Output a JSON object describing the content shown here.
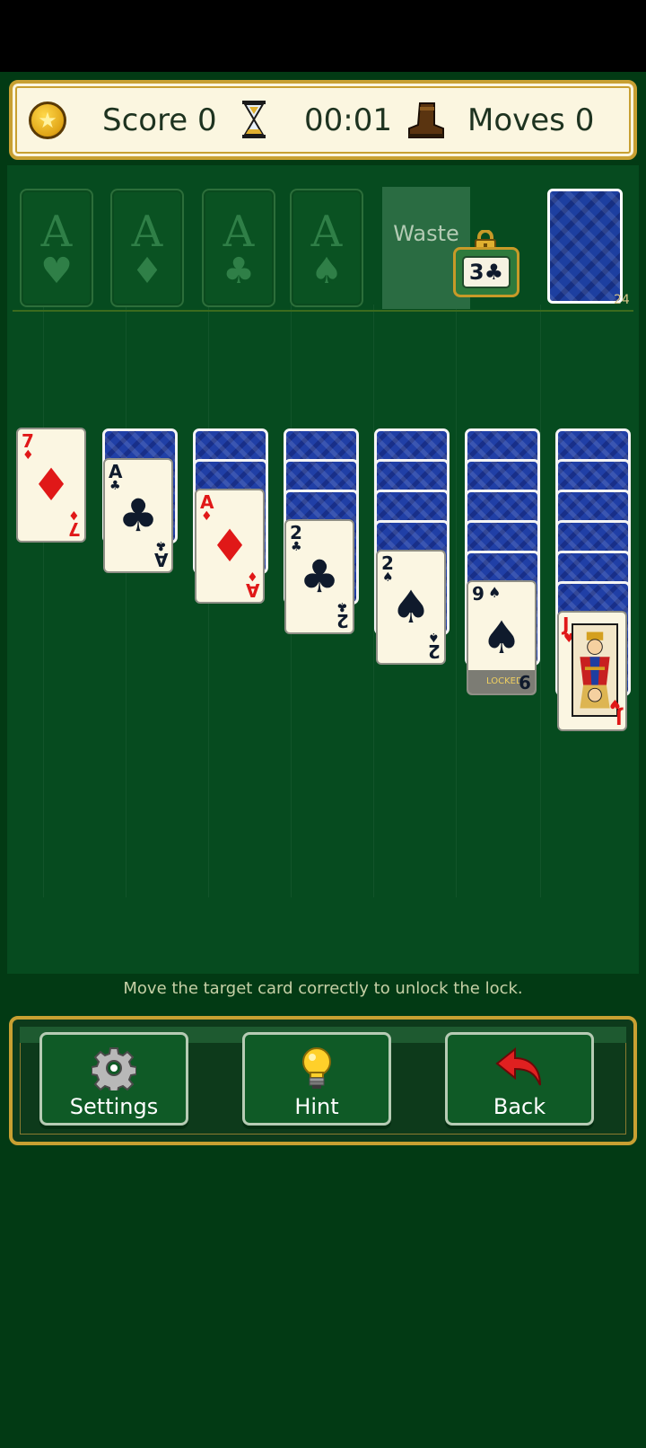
{
  "header": {
    "score_label": "Score 0",
    "time": "00:01",
    "moves_label": "Moves 0",
    "icons": [
      "coin-star-icon",
      "hourglass-icon",
      "boot-icon"
    ]
  },
  "foundations": [
    {
      "letter": "A",
      "suit": "♥"
    },
    {
      "letter": "A",
      "suit": "♦"
    },
    {
      "letter": "A",
      "suit": "♣"
    },
    {
      "letter": "A",
      "suit": "♠"
    }
  ],
  "waste_label": "Waste",
  "stock_count": "24",
  "tableau": {
    "col1": {
      "rank": "7",
      "suit": "♦"
    },
    "col2": {
      "rank": "A",
      "suit": "♣"
    },
    "col3": {
      "rank": "A",
      "suit": "♦"
    },
    "col4": {
      "rank": "2",
      "suit": "♣"
    },
    "col5": {
      "rank": "2",
      "suit": "♠"
    },
    "col6": {
      "rank": "9",
      "suit": "♠",
      "locked_label": "LOCKED",
      "lock_target": "3♣"
    },
    "col7": {
      "rank": "J",
      "suit": "♥"
    }
  },
  "message": "Move the target card correctly to unlock the lock.",
  "buttons": {
    "settings": "Settings",
    "hint": "Hint",
    "back": "Back"
  },
  "colors": {
    "felt": "#064b1f",
    "gold_border": "#c8a032",
    "card_back": "#203fa6",
    "red_suit": "#e01818"
  }
}
